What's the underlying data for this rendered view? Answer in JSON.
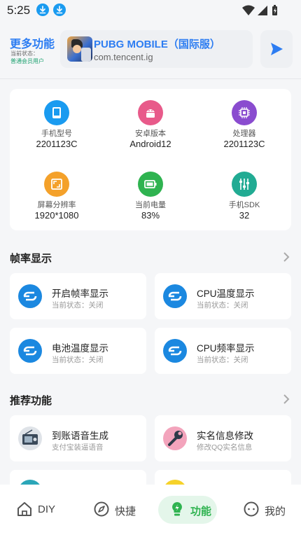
{
  "status_bar": {
    "time": "5:25"
  },
  "header": {
    "title": "更多功能",
    "status_label": "当前状态：",
    "status_value": "普通会员用户",
    "app": {
      "name": "PUBG MOBILE（国际服）",
      "package": "com.tencent.ig"
    }
  },
  "device_info": [
    {
      "label": "手机型号",
      "value": "2201123C",
      "icon": "tablet-icon",
      "color": "#1a9bf0"
    },
    {
      "label": "安卓版本",
      "value": "Android12",
      "icon": "android-icon",
      "color": "#e85a8a"
    },
    {
      "label": "处理器",
      "value": "2201123C",
      "icon": "chip-icon",
      "color": "#8a4ccf"
    },
    {
      "label": "屏幕分辨率",
      "value": "1920*1080",
      "icon": "screen-icon",
      "color": "#f4a12a"
    },
    {
      "label": "当前电量",
      "value": "83%",
      "icon": "battery-icon",
      "color": "#2fb350"
    },
    {
      "label": "手机SDK",
      "value": "32",
      "icon": "sliders-icon",
      "color": "#21ab93"
    }
  ],
  "fps_section": {
    "title": "帧率显示",
    "items": [
      {
        "name": "开启帧率显示",
        "sub": "当前状态：关闭"
      },
      {
        "name": "CPU温度显示",
        "sub": "当前状态：关闭"
      },
      {
        "name": "电池温度显示",
        "sub": "当前状态：关闭"
      },
      {
        "name": "CPU频率显示",
        "sub": "当前状态：关闭"
      }
    ]
  },
  "recommend_section": {
    "title": "推荐功能",
    "items": [
      {
        "name": "到账语音生成",
        "sub": "支付宝装逼语音"
      },
      {
        "name": "实名信息修改",
        "sub": "修改QQ实名信息"
      }
    ]
  },
  "bottom_nav": [
    {
      "label": "DIY",
      "icon": "home-icon"
    },
    {
      "label": "快捷",
      "icon": "compass-icon"
    },
    {
      "label": "功能",
      "icon": "lightbulb-icon",
      "active": true
    },
    {
      "label": "我的",
      "icon": "chat-face-icon"
    }
  ],
  "colors": {
    "accent": "#2d7df2",
    "func_blue": "#1b88e0",
    "nav_active": "#2fb350"
  }
}
